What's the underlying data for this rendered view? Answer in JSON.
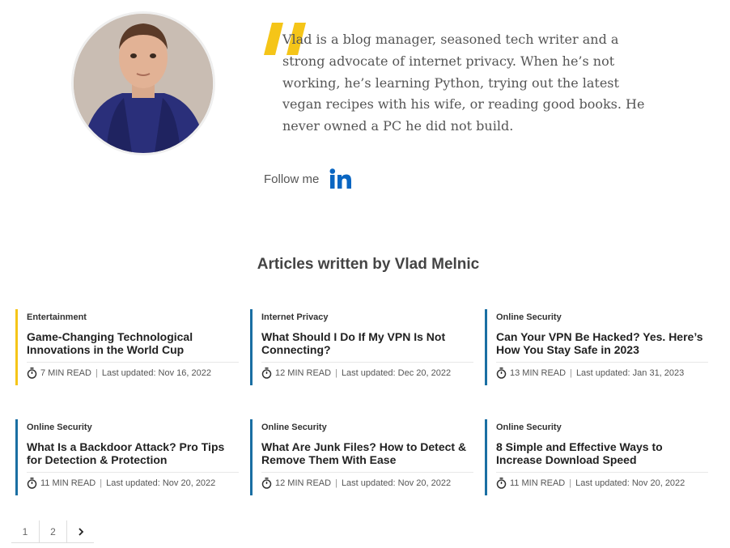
{
  "author": {
    "bio": "Vlad is a blog manager, seasoned tech writer and a strong advocate of internet privacy. When he’s not working, he’s learning Python, trying out the latest vegan recipes with his wife, or reading good books. He never owned a PC he did not build.",
    "follow_label": "Follow me",
    "social_icon": "linkedin-icon"
  },
  "articles_heading": "Articles written by Vlad Melnic",
  "colors": {
    "accent_yellow": "#f5c518",
    "accent_blue": "#1a6fa3",
    "linkedin": "#0a66c2"
  },
  "articles": [
    {
      "category": "Entertainment",
      "title": "Game-Changing Technological Innovations in the World Cup",
      "read_time": "7 MIN READ",
      "updated": "Last updated: Nov 16, 2022"
    },
    {
      "category": "Internet Privacy",
      "title": "What Should I Do If My VPN Is Not Connecting?",
      "read_time": "12 MIN READ",
      "updated": "Last updated: Dec 20, 2022"
    },
    {
      "category": "Online Security",
      "title": "Can Your VPN Be Hacked? Yes. Here’s How You Stay Safe in 2023",
      "read_time": "13 MIN READ",
      "updated": "Last updated: Jan 31, 2023"
    },
    {
      "category": "Online Security",
      "title": "What Is a Backdoor Attack? Pro Tips for Detection & Protection",
      "read_time": "11 MIN READ",
      "updated": "Last updated: Nov 20, 2022"
    },
    {
      "category": "Online Security",
      "title": "What Are Junk Files? How to Detect & Remove Them With Ease",
      "read_time": "12 MIN READ",
      "updated": "Last updated: Nov 20, 2022"
    },
    {
      "category": "Online Security",
      "title": "8 Simple and Effective Ways to Increase Download Speed",
      "read_time": "11 MIN READ",
      "updated": "Last updated: Nov 20, 2022"
    }
  ],
  "pagination": {
    "pages": [
      "1",
      "2"
    ],
    "next_icon": "chevron-right-icon"
  }
}
